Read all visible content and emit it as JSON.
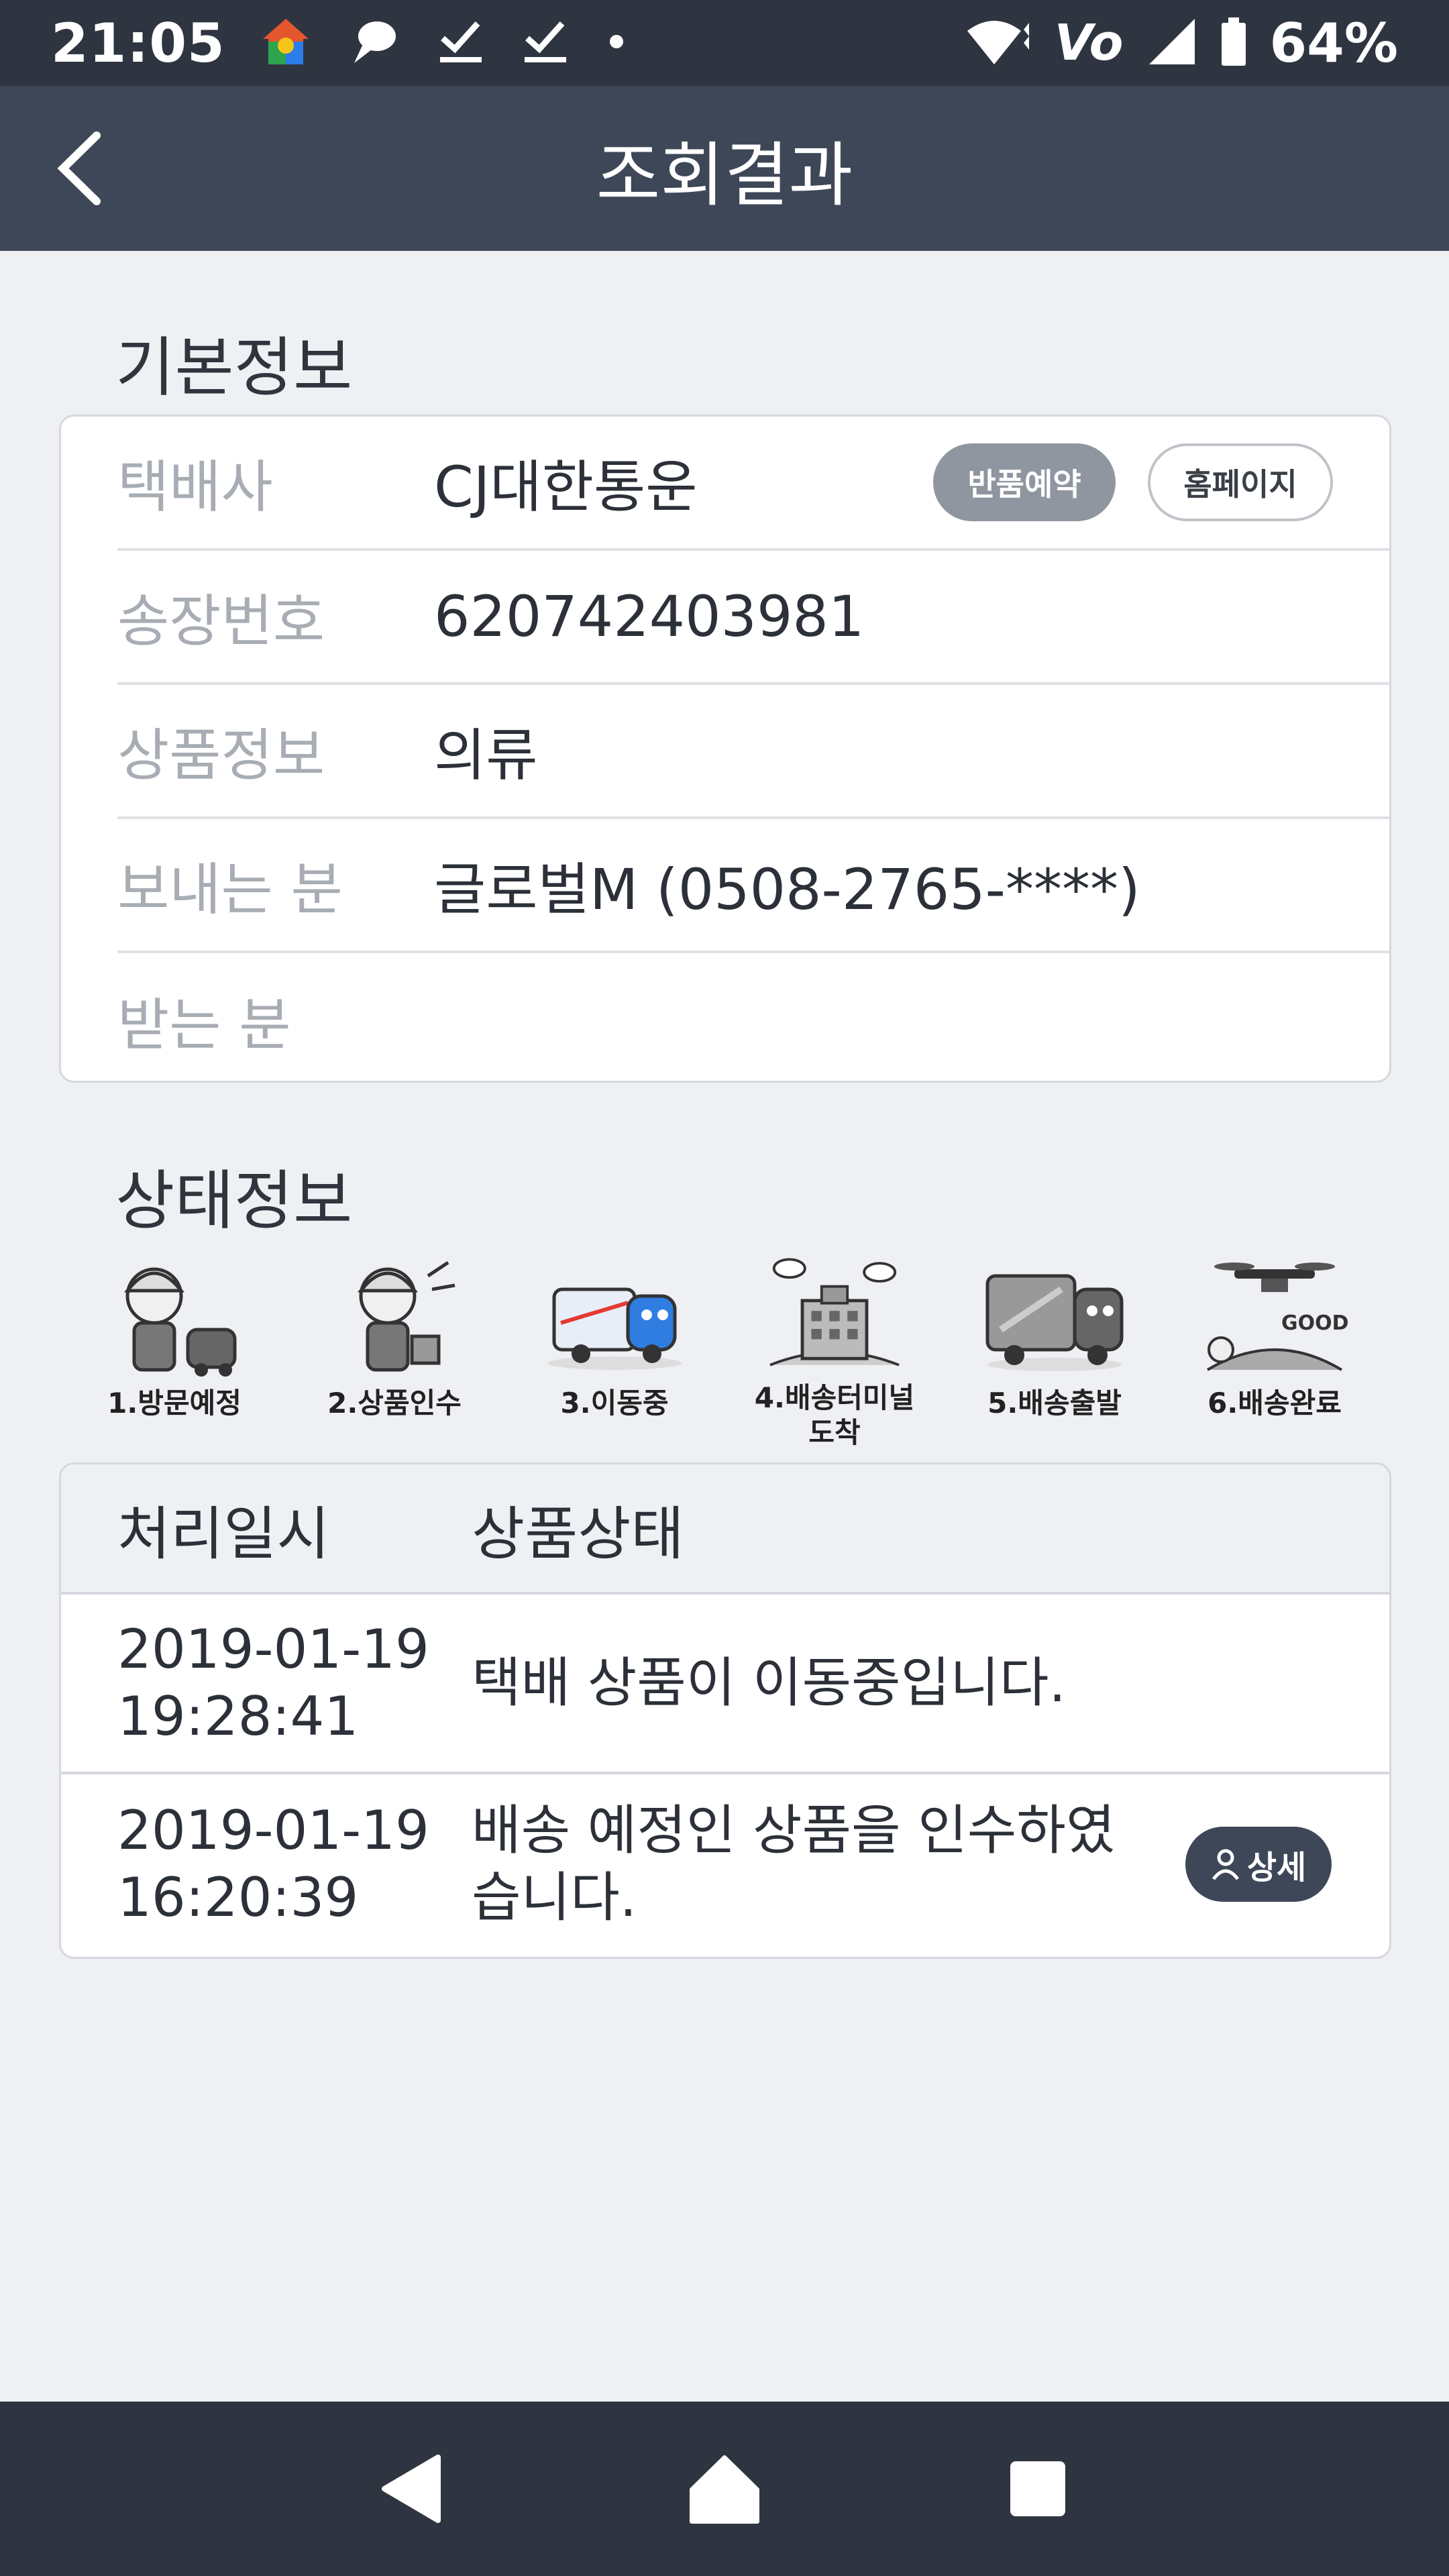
{
  "status_bar": {
    "time": "21:05",
    "battery_percent": "64%",
    "volte": "Vo",
    "icons": [
      "home-app-icon",
      "chat-icon",
      "check-icon",
      "check-icon",
      "dot-icon",
      "wifi-icon",
      "volte-icon",
      "signal-icon",
      "battery-icon"
    ]
  },
  "header": {
    "title": "조회결과",
    "back_icon": "chevron-left-icon"
  },
  "basic_info": {
    "section_title": "기본정보",
    "rows": [
      {
        "label": "택배사",
        "value": "CJ대한통운"
      },
      {
        "label": "송장번호",
        "value": "620742403981"
      },
      {
        "label": "상품정보",
        "value": "의류"
      },
      {
        "label": "보내는 분",
        "value": "글로벌M (0508-2765-****)"
      },
      {
        "label": "받는 분",
        "value": ")"
      }
    ],
    "return_button": "반품예약",
    "homepage_button": "홈페이지"
  },
  "status_info": {
    "section_title": "상태정보",
    "steps": [
      {
        "label": "1.방문예정",
        "icon": "courier-visit-icon"
      },
      {
        "label": "2.상품인수",
        "icon": "courier-pickup-icon"
      },
      {
        "label": "3.이동중",
        "icon": "moving-truck-icon"
      },
      {
        "label": "4.배송터미널\n도착",
        "icon": "terminal-building-icon"
      },
      {
        "label": "5.배송출발",
        "icon": "delivery-truck-icon"
      },
      {
        "label": "6.배송완료",
        "icon": "drone-delivered-icon"
      }
    ],
    "current_step": 3
  },
  "history": {
    "columns": [
      "처리일시",
      "상품상태"
    ],
    "rows": [
      {
        "date": "2019-01-19",
        "time": "19:28:41",
        "status": "택배 상품이 이동중입니다."
      },
      {
        "date": "2019-01-19",
        "time": "16:20:39",
        "status": "배송 예정인 상품을 인수하였습니다.",
        "detail_button": "상세"
      }
    ]
  },
  "nav_bar": {
    "icons": [
      "back-triangle-icon",
      "home-icon",
      "recents-square-icon"
    ]
  }
}
